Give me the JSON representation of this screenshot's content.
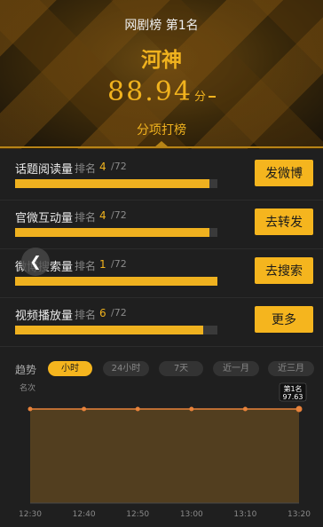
{
  "header": {
    "rank_text": "网剧榜  第1名",
    "title": "河神",
    "score": "88.94",
    "score_unit": "分",
    "subtitle": "分项打榜"
  },
  "metrics": [
    {
      "label": "话题阅读量",
      "rank_label": "排名",
      "rank": "4",
      "total": "/72",
      "fill": 0.96,
      "button": "发微博"
    },
    {
      "label": "官微互动量",
      "rank_label": "排名",
      "rank": "4",
      "total": "/72",
      "fill": 0.96,
      "button": "去转发"
    },
    {
      "label": "微博搜索量",
      "rank_label": "排名",
      "rank": "1",
      "total": "/72",
      "fill": 1.0,
      "button": "去搜索"
    },
    {
      "label": "视频播放量",
      "rank_label": "排名",
      "rank": "6",
      "total": "/72",
      "fill": 0.93,
      "button": "更多"
    }
  ],
  "trend": {
    "label": "趋势",
    "tabs": [
      "小时",
      "24小时",
      "7天",
      "近一月",
      "近三月"
    ],
    "active_tab": 0,
    "y_axis_label": "名次"
  },
  "chart_data": {
    "type": "area",
    "x": [
      "12:30",
      "12:40",
      "12:50",
      "13:00",
      "13:10",
      "13:20"
    ],
    "series": [
      {
        "values": [
          1,
          1,
          1,
          1,
          1,
          1
        ]
      }
    ],
    "ylabel": "名次",
    "tooltip": {
      "line1": "第1名",
      "line2": "97.63"
    },
    "colors": {
      "line": "#e8823a",
      "fill": "#5c4420",
      "point": "#e8823a"
    }
  },
  "colors": {
    "accent": "#f5b51e",
    "background": "#1f1f1f"
  }
}
